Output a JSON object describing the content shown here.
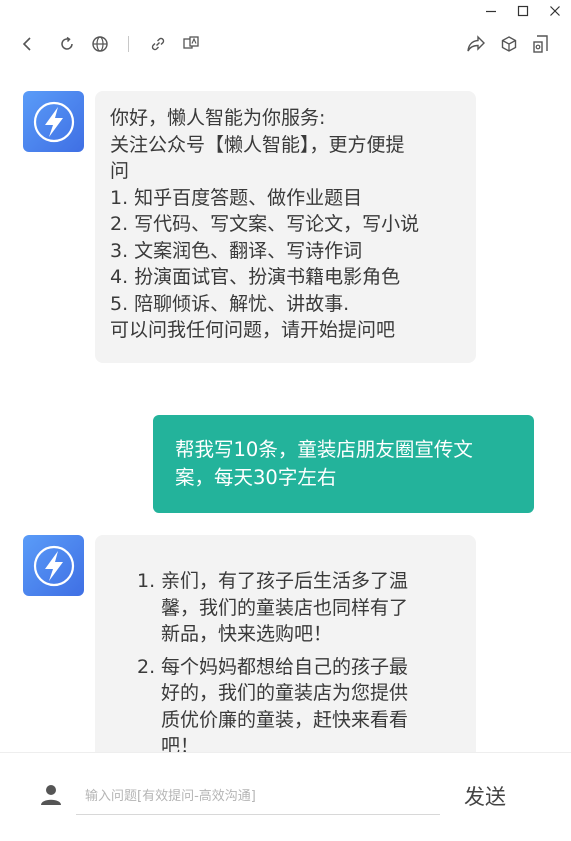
{
  "window": {
    "minimize_icon": "minimize-icon",
    "maximize_icon": "maximize-icon",
    "close_icon": "close-icon"
  },
  "toolbar": {
    "icons": [
      "back-icon",
      "refresh-icon",
      "globe-icon",
      "link-icon",
      "translate-icon",
      "share-icon",
      "cube-icon",
      "bookmark-icon"
    ]
  },
  "colors": {
    "user_bubble": "#23b39b",
    "bot_bubble": "#f3f3f3",
    "avatar_gradient_start": "#5a9cf8",
    "avatar_gradient_end": "#3f6fe4"
  },
  "chat": {
    "welcome_lines": [
      "你好，懒人智能为你服务:",
      "关注公众号【懒人智能】，更方便提",
      "问",
      "1. 知乎百度答题、做作业题目",
      "2. 写代码、写文案、写论文，写小说",
      "3. 文案润色、翻译、写诗作词",
      "4. 扮演面试官、扮演书籍电影角色",
      "5. 陪聊倾诉、解忧、讲故事.",
      "可以问我任何问题，请开始提问吧"
    ],
    "user_message_lines": [
      "帮我写10条，童装店朋友圈宣传文",
      "案，每天30字左右"
    ],
    "reply_items": [
      {
        "num": "1.",
        "lines": [
          "亲们，有了孩子后生活多了温",
          "馨，我们的童装店也同样有了",
          "新品，快来选购吧！"
        ]
      },
      {
        "num": "2.",
        "lines": [
          "每个妈妈都想给自己的孩子最",
          "好的，我们的童装店为您提供",
          "质优价廉的童装，赶快来看看",
          "吧！"
        ]
      }
    ]
  },
  "input": {
    "placeholder": "输入问题[有效提问-高效沟通]",
    "value": "",
    "send_label": "发送"
  }
}
